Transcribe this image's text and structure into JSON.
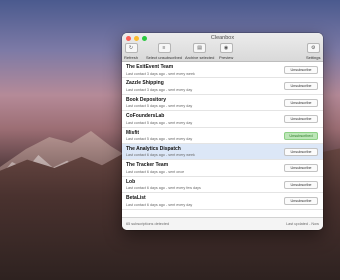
{
  "window": {
    "title": "Cleanbox"
  },
  "toolbar": {
    "refresh_label": "Refresh",
    "select_label": "Select unsubscribed",
    "archive_label": "Archive selected",
    "preview_label": "Preview",
    "settings_label": "Settings"
  },
  "subscriptions": [
    {
      "name": "The ExitEvent Team",
      "meta": "Last contact 3 days ago - sent every week",
      "action": "Unsubscribe"
    },
    {
      "name": "Zazzle Shipping",
      "meta": "Last contact 3 days ago - sent every day",
      "action": "Unsubscribe"
    },
    {
      "name": "Book Depository",
      "meta": "Last contact 5 days ago - sent every day",
      "action": "Unsubscribe"
    },
    {
      "name": "CoFoundersLab",
      "meta": "Last contact 5 days ago - sent every day",
      "action": "Unsubscribe"
    },
    {
      "name": "Misfit",
      "meta": "Last contact 5 days ago - sent every day",
      "action": "Unsubscribed"
    },
    {
      "name": "The Analytics Dispatch",
      "meta": "Last contact 6 days ago - sent every week",
      "action": "Unsubscribe"
    },
    {
      "name": "The Tracker Team",
      "meta": "Last contact 6 days ago - sent once",
      "action": "Unsubscribe"
    },
    {
      "name": "Lob",
      "meta": "Last contact 6 days ago - sent every few days",
      "action": "Unsubscribe"
    },
    {
      "name": "BetaList",
      "meta": "Last contact 6 days ago - sent every day",
      "action": "Unsubscribe"
    }
  ],
  "footer": {
    "detected": "65 subscriptions detected",
    "updated": "Last updated - Now"
  },
  "colors": {
    "selected_row": "#dce7f7",
    "unsubscribed_badge": "#bde6b8"
  }
}
